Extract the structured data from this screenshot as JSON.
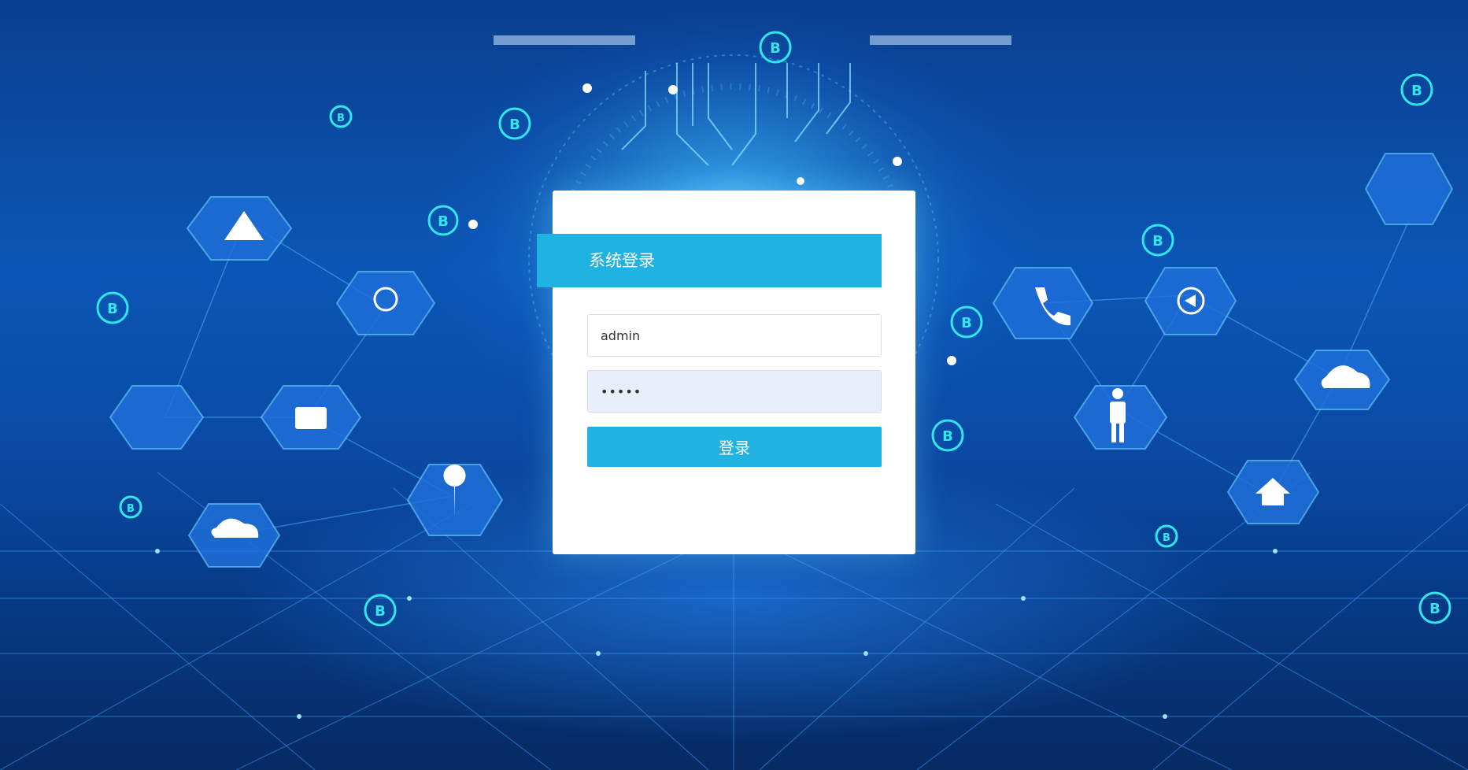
{
  "login": {
    "title": "系统登录",
    "username_value": "admin",
    "password_value": "•••••",
    "submit_label": "登录"
  },
  "colors": {
    "accent": "#20b3e2",
    "card_background": "#ffffff",
    "password_field_background": "#e9effa",
    "background_primary": "#0b56b5"
  },
  "decorations": {
    "background_theme": "blue-tech-network",
    "icons": [
      "triangle-icon",
      "lightbulb-icon",
      "folder-icon",
      "location-pin-icon",
      "cloud-download-icon",
      "phone-icon",
      "play-back-icon",
      "person-icon",
      "cloud-upload-icon",
      "home-icon",
      "bitcoin-icon"
    ]
  }
}
